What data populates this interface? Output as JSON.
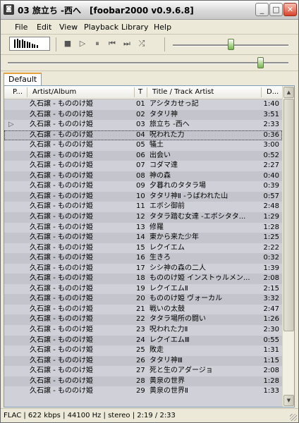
{
  "window": {
    "title": "03 旅立ち -西へ　[foobar2000 v0.9.6.8]"
  },
  "menu": [
    "File",
    "Edit",
    "View",
    "Playback",
    "Library",
    "Help"
  ],
  "tabs": [
    "Default"
  ],
  "columns": [
    "P...",
    "Artist/Album",
    "T",
    "Title / Track Artist",
    "D..."
  ],
  "rows": [
    {
      "artist": "久石譲 - もののけ姫",
      "no": "01",
      "title": "アシタカせっ記",
      "dur": "1:40"
    },
    {
      "artist": "久石譲 - もののけ姫",
      "no": "02",
      "title": "タタリ神",
      "dur": "3:51"
    },
    {
      "artist": "久石譲 - もののけ姫",
      "no": "03",
      "title": "旅立ち -西へ",
      "dur": "2:33"
    },
    {
      "artist": "久石譲 - もののけ姫",
      "no": "04",
      "title": "呪われた力",
      "dur": "0:36"
    },
    {
      "artist": "久石譲 - もののけ姫",
      "no": "05",
      "title": "犠土",
      "dur": "3:00"
    },
    {
      "artist": "久石譲 - もののけ姫",
      "no": "06",
      "title": "出会い",
      "dur": "0:52"
    },
    {
      "artist": "久石譲 - もののけ姫",
      "no": "07",
      "title": "コダマ達",
      "dur": "2:27"
    },
    {
      "artist": "久石譲 - もののけ姫",
      "no": "08",
      "title": "神の森",
      "dur": "0:40"
    },
    {
      "artist": "久石譲 - もののけ姫",
      "no": "09",
      "title": "夕暮れのタタラ場",
      "dur": "0:39"
    },
    {
      "artist": "久石譲 - もののけ姫",
      "no": "10",
      "title": "タタリ神Ⅱ -うばわれた山",
      "dur": "0:57"
    },
    {
      "artist": "久石譲 - もののけ姫",
      "no": "11",
      "title": "エボシ御前",
      "dur": "2:48"
    },
    {
      "artist": "久石譲 - もののけ姫",
      "no": "12",
      "title": "タタラ踏む女達 -エボシタタ...",
      "dur": "1:29"
    },
    {
      "artist": "久石譲 - もののけ姫",
      "no": "13",
      "title": "修羅",
      "dur": "1:28"
    },
    {
      "artist": "久石譲 - もののけ姫",
      "no": "14",
      "title": "東から来た少年",
      "dur": "1:25"
    },
    {
      "artist": "久石譲 - もののけ姫",
      "no": "15",
      "title": "レクイエム",
      "dur": "2:22"
    },
    {
      "artist": "久石譲 - もののけ姫",
      "no": "16",
      "title": "生きろ",
      "dur": "0:32"
    },
    {
      "artist": "久石譲 - もののけ姫",
      "no": "17",
      "title": "シシ神の森の二人",
      "dur": "1:39"
    },
    {
      "artist": "久石譲 - もののけ姫",
      "no": "18",
      "title": "もののけ姫 インストゥルメン...",
      "dur": "2:08"
    },
    {
      "artist": "久石譲 - もののけ姫",
      "no": "19",
      "title": "レクイエムⅡ",
      "dur": "2:15"
    },
    {
      "artist": "久石譲 - もののけ姫",
      "no": "20",
      "title": "もののけ姫 ヴォーカル",
      "dur": "3:32"
    },
    {
      "artist": "久石譲 - もののけ姫",
      "no": "21",
      "title": "戦いの太鼓",
      "dur": "2:47"
    },
    {
      "artist": "久石譲 - もののけ姫",
      "no": "22",
      "title": "タタラ場所の闘い",
      "dur": "1:26"
    },
    {
      "artist": "久石譲 - もののけ姫",
      "no": "23",
      "title": "呪われた力Ⅱ",
      "dur": "2:30"
    },
    {
      "artist": "久石譲 - もののけ姫",
      "no": "24",
      "title": "レクイエムⅢ",
      "dur": "0:55"
    },
    {
      "artist": "久石譲 - もののけ姫",
      "no": "25",
      "title": "敗走",
      "dur": "1:31"
    },
    {
      "artist": "久石譲 - もののけ姫",
      "no": "26",
      "title": "タタリ神Ⅲ",
      "dur": "1:15"
    },
    {
      "artist": "久石譲 - もののけ姫",
      "no": "27",
      "title": "死と生のアダージョ",
      "dur": "2:08"
    },
    {
      "artist": "久石譲 - もののけ姫",
      "no": "28",
      "title": "黄泉の世界",
      "dur": "1:28"
    },
    {
      "artist": "久石譲 - もののけ姫",
      "no": "29",
      "title": "黄泉の世界Ⅱ",
      "dur": "1:33"
    }
  ],
  "playing_row": 2,
  "focused_row": 3,
  "status": "FLAC | 622 kbps | 44100 Hz | stereo | 2:19 / 2:33",
  "volume": 0.5,
  "seek_position": 0.91,
  "icons": {
    "app": "foobar-icon",
    "minimize": "minimize-icon",
    "maximize": "maximize-icon",
    "close": "close-icon",
    "stop": "stop-icon",
    "play": "play-icon",
    "pause": "pause-icon",
    "prev": "previous-icon",
    "next": "next-icon",
    "random": "random-icon",
    "now_playing": "play-indicator-icon"
  },
  "colors": {
    "list_bg": "#d0d0d8",
    "list_alt": "#c4c4cc",
    "slider_thumb": "#79b558"
  }
}
